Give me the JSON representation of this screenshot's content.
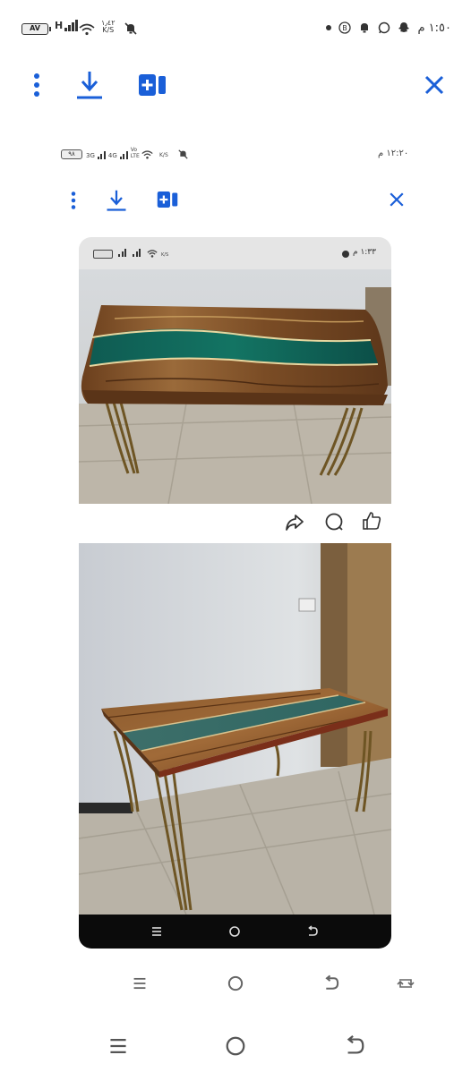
{
  "outer_status": {
    "battery": "AV",
    "network": "H",
    "speed_value": "١٫٤٢",
    "speed_unit": "K/S",
    "time": "١:٥٠ م",
    "icons": [
      "mute-icon",
      "dot-icon",
      "b-circle-icon",
      "bell-icon",
      "whatsapp-icon",
      "snapchat-icon"
    ]
  },
  "outer_toolbar": {
    "icons": [
      "more-icon",
      "download-icon",
      "add-to-device-icon",
      "close-icon"
    ],
    "accent": "#1a5fd8"
  },
  "inner_status": {
    "battery": "٩٨",
    "net1": "3G",
    "net2": "4G",
    "volte": "Vo LTE",
    "speed_unit": "K/S",
    "time": "١٢:٢٠ م"
  },
  "inner_toolbar": {
    "icons": [
      "more-icon",
      "download-icon",
      "add-to-device-icon",
      "close-icon"
    ]
  },
  "phone": {
    "status_time": "١:٣٣ م",
    "status_speed_unit": "K/S",
    "post_actions": [
      "share-icon",
      "comment-icon",
      "like-icon"
    ],
    "nav": [
      "menu-icon",
      "home-icon",
      "back-icon"
    ]
  },
  "photos": [
    {
      "subject": "resin-river-table-top-view"
    },
    {
      "subject": "resin-river-table-angle-view"
    }
  ],
  "bottom_nav_inner": [
    "menu-icon",
    "home-icon",
    "back-icon",
    "rotate-icon"
  ],
  "bottom_nav_outer": [
    "menu-icon",
    "home-icon",
    "back-icon"
  ]
}
